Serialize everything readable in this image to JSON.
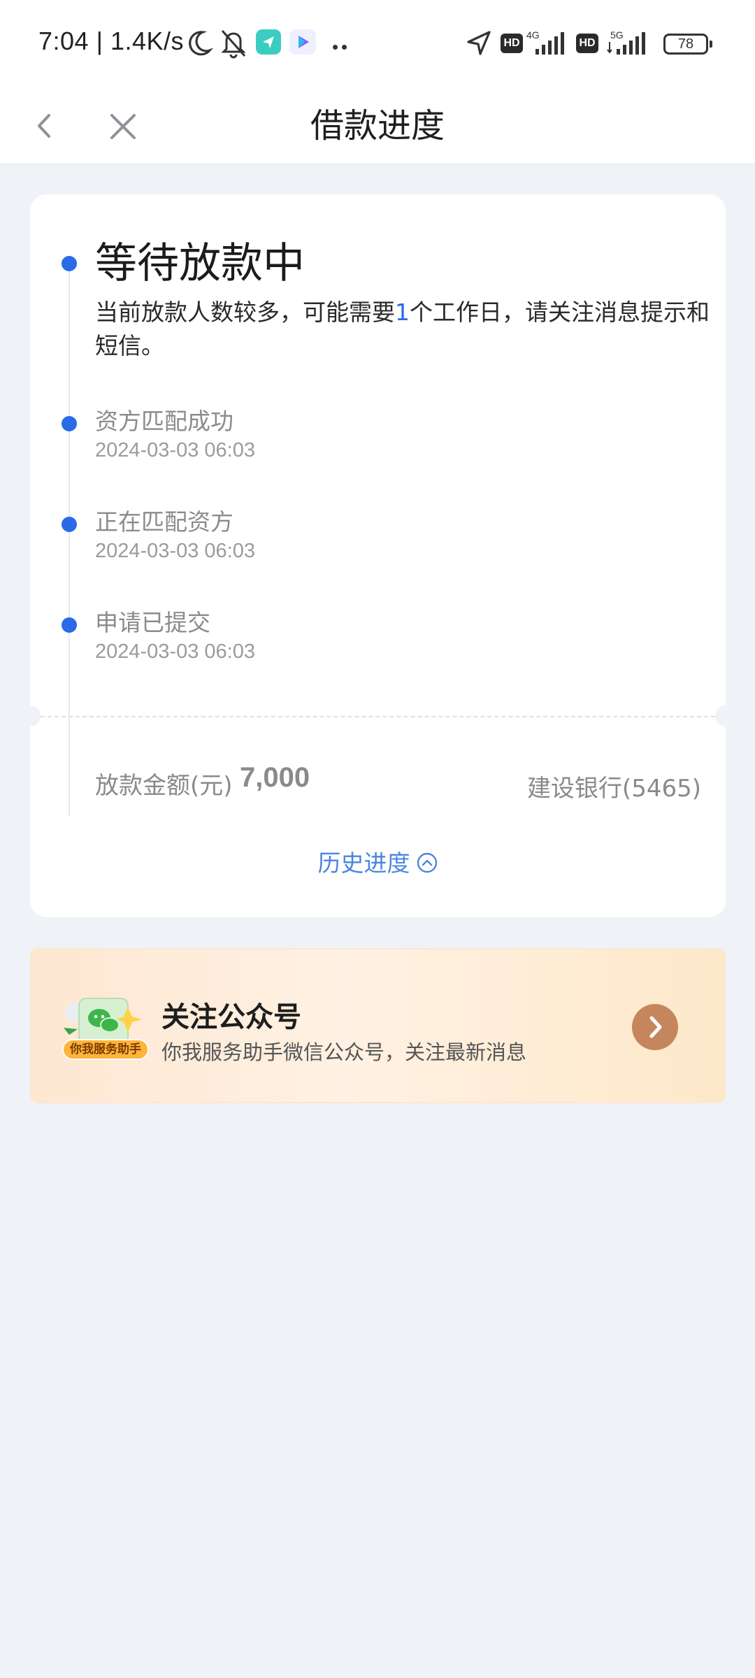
{
  "status_bar": {
    "time": "7:04",
    "speed": "1.4K/s",
    "hd1": "HD",
    "net1": "4G",
    "hd2": "HD",
    "net2": "5G",
    "battery": "78"
  },
  "header": {
    "title": "借款进度",
    "back_icon": "chevron-left-icon",
    "close_icon": "close-icon"
  },
  "progress": {
    "current": {
      "title": "等待放款中",
      "desc_before": "当前放款人数较多，可能需要",
      "desc_highlight": "1",
      "desc_after": "个工作日，请关注消息提示和短信。"
    },
    "steps": [
      {
        "title": "资方匹配成功",
        "time": "2024-03-03 06:03"
      },
      {
        "title": "正在匹配资方",
        "time": "2024-03-03 06:03"
      },
      {
        "title": "申请已提交",
        "time": "2024-03-03 06:03"
      }
    ],
    "accent_color": "#2a6ae8"
  },
  "loan": {
    "amount_label": "放款金额(元)",
    "amount_value": "7,000",
    "bank": "建设银行(5465)",
    "history_link": "历史进度"
  },
  "banner": {
    "logo_label": "你我服务助手",
    "title": "关注公众号",
    "subtitle": "你我服务助手微信公众号，关注最新消息",
    "arrow_icon": "chevron-right-icon"
  }
}
